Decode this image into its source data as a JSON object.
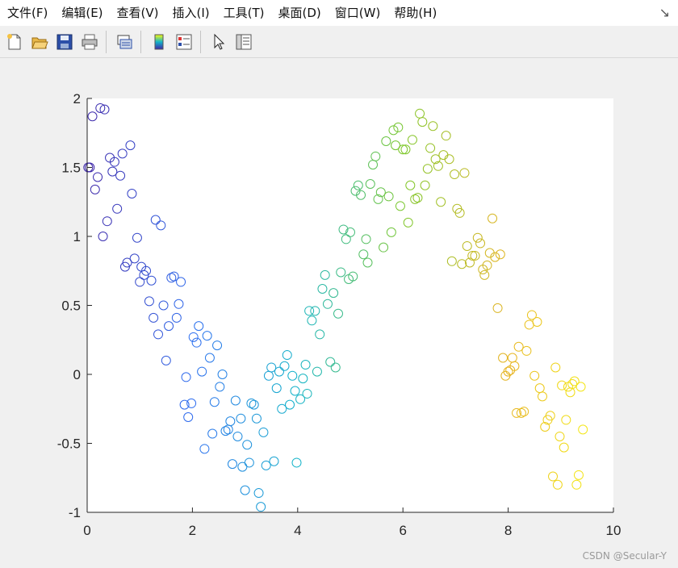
{
  "menu": {
    "items": [
      "文件(F)",
      "编辑(E)",
      "查看(V)",
      "插入(I)",
      "工具(T)",
      "桌面(D)",
      "窗口(W)",
      "帮助(H)"
    ]
  },
  "toolbar": {
    "buttons": [
      "new-figure-icon",
      "open-file-icon",
      "save-icon",
      "print-icon",
      "link-plot-icon",
      "colorbar-icon",
      "legend-icon",
      "edit-plot-arrow-icon",
      "property-inspector-icon"
    ]
  },
  "chart_data": {
    "type": "scatter",
    "marker": "open-circle",
    "color_map": "parula",
    "colors": [
      "#3e26a8",
      "#2f6ff0",
      "#13b4c9",
      "#7cc72a",
      "#e6b321",
      "#f9fb0e"
    ],
    "xlim": [
      0,
      10
    ],
    "ylim": [
      -1,
      2
    ],
    "xticks": [
      "0",
      "2",
      "4",
      "6",
      "8",
      "10"
    ],
    "yticks": [
      "-1",
      "-0.5",
      "0",
      "0.5",
      "1",
      "1.5",
      "2"
    ],
    "grid": false,
    "points": [
      [
        0.02,
        1.5
      ],
      [
        0.05,
        1.5
      ],
      [
        0.1,
        1.87
      ],
      [
        0.15,
        1.34
      ],
      [
        0.2,
        1.43
      ],
      [
        0.25,
        1.93
      ],
      [
        0.3,
        1.0
      ],
      [
        0.33,
        1.92
      ],
      [
        0.38,
        1.11
      ],
      [
        0.43,
        1.57
      ],
      [
        0.48,
        1.47
      ],
      [
        0.52,
        1.54
      ],
      [
        0.57,
        1.2
      ],
      [
        0.63,
        1.44
      ],
      [
        0.67,
        1.6
      ],
      [
        0.72,
        0.78
      ],
      [
        0.76,
        0.81
      ],
      [
        0.82,
        1.66
      ],
      [
        0.85,
        1.31
      ],
      [
        0.9,
        0.84
      ],
      [
        0.95,
        0.99
      ],
      [
        1.0,
        0.67
      ],
      [
        1.03,
        0.78
      ],
      [
        1.08,
        0.72
      ],
      [
        1.12,
        0.75
      ],
      [
        1.18,
        0.53
      ],
      [
        1.22,
        0.68
      ],
      [
        1.26,
        0.41
      ],
      [
        1.3,
        1.12
      ],
      [
        1.35,
        0.29
      ],
      [
        1.4,
        1.08
      ],
      [
        1.45,
        0.5
      ],
      [
        1.5,
        0.1
      ],
      [
        1.55,
        0.35
      ],
      [
        1.6,
        0.7
      ],
      [
        1.65,
        0.71
      ],
      [
        1.7,
        0.41
      ],
      [
        1.74,
        0.51
      ],
      [
        1.78,
        0.67
      ],
      [
        1.85,
        -0.22
      ],
      [
        1.88,
        -0.02
      ],
      [
        1.92,
        -0.31
      ],
      [
        1.98,
        -0.21
      ],
      [
        2.02,
        0.27
      ],
      [
        2.08,
        0.23
      ],
      [
        2.12,
        0.35
      ],
      [
        2.18,
        0.02
      ],
      [
        2.23,
        -0.54
      ],
      [
        2.28,
        0.28
      ],
      [
        2.33,
        0.12
      ],
      [
        2.38,
        -0.43
      ],
      [
        2.42,
        -0.2
      ],
      [
        2.47,
        0.21
      ],
      [
        2.52,
        -0.09
      ],
      [
        2.57,
        0.0
      ],
      [
        2.63,
        -0.41
      ],
      [
        2.68,
        -0.4
      ],
      [
        2.72,
        -0.34
      ],
      [
        2.76,
        -0.65
      ],
      [
        2.82,
        -0.19
      ],
      [
        2.86,
        -0.45
      ],
      [
        2.92,
        -0.32
      ],
      [
        2.95,
        -0.67
      ],
      [
        3.0,
        -0.84
      ],
      [
        3.04,
        -0.51
      ],
      [
        3.08,
        -0.64
      ],
      [
        3.12,
        -0.21
      ],
      [
        3.17,
        -0.22
      ],
      [
        3.22,
        -0.32
      ],
      [
        3.26,
        -0.86
      ],
      [
        3.3,
        -0.96
      ],
      [
        3.35,
        -0.42
      ],
      [
        3.4,
        -0.66
      ],
      [
        3.45,
        -0.01
      ],
      [
        3.5,
        0.05
      ],
      [
        3.55,
        -0.63
      ],
      [
        3.6,
        -0.1
      ],
      [
        3.65,
        0.02
      ],
      [
        3.7,
        -0.25
      ],
      [
        3.75,
        0.06
      ],
      [
        3.8,
        0.14
      ],
      [
        3.85,
        -0.22
      ],
      [
        3.9,
        -0.01
      ],
      [
        3.95,
        -0.12
      ],
      [
        3.98,
        -0.64
      ],
      [
        4.05,
        -0.18
      ],
      [
        4.1,
        -0.03
      ],
      [
        4.15,
        0.07
      ],
      [
        4.18,
        -0.14
      ],
      [
        4.22,
        0.46
      ],
      [
        4.27,
        0.39
      ],
      [
        4.33,
        0.46
      ],
      [
        4.37,
        0.02
      ],
      [
        4.42,
        0.29
      ],
      [
        4.47,
        0.62
      ],
      [
        4.52,
        0.72
      ],
      [
        4.57,
        0.51
      ],
      [
        4.62,
        0.09
      ],
      [
        4.68,
        0.59
      ],
      [
        4.72,
        0.05
      ],
      [
        4.77,
        0.44
      ],
      [
        4.82,
        0.74
      ],
      [
        4.87,
        1.05
      ],
      [
        4.92,
        0.98
      ],
      [
        4.97,
        0.69
      ],
      [
        5.0,
        1.03
      ],
      [
        5.05,
        0.71
      ],
      [
        5.1,
        1.33
      ],
      [
        5.15,
        1.37
      ],
      [
        5.2,
        1.3
      ],
      [
        5.25,
        0.87
      ],
      [
        5.3,
        0.98
      ],
      [
        5.33,
        0.81
      ],
      [
        5.38,
        1.38
      ],
      [
        5.43,
        1.52
      ],
      [
        5.48,
        1.58
      ],
      [
        5.53,
        1.27
      ],
      [
        5.58,
        1.32
      ],
      [
        5.63,
        0.92
      ],
      [
        5.68,
        1.69
      ],
      [
        5.73,
        1.29
      ],
      [
        5.78,
        1.03
      ],
      [
        5.82,
        1.77
      ],
      [
        5.86,
        1.66
      ],
      [
        5.91,
        1.79
      ],
      [
        5.95,
        1.22
      ],
      [
        6.0,
        1.63
      ],
      [
        6.05,
        1.63
      ],
      [
        6.1,
        1.1
      ],
      [
        6.14,
        1.37
      ],
      [
        6.18,
        1.7
      ],
      [
        6.23,
        1.27
      ],
      [
        6.28,
        1.28
      ],
      [
        6.32,
        1.89
      ],
      [
        6.37,
        1.83
      ],
      [
        6.42,
        1.37
      ],
      [
        6.47,
        1.49
      ],
      [
        6.52,
        1.64
      ],
      [
        6.57,
        1.8
      ],
      [
        6.62,
        1.56
      ],
      [
        6.67,
        1.51
      ],
      [
        6.72,
        1.25
      ],
      [
        6.77,
        1.59
      ],
      [
        6.82,
        1.73
      ],
      [
        6.88,
        1.56
      ],
      [
        6.93,
        0.82
      ],
      [
        6.98,
        1.45
      ],
      [
        7.03,
        1.2
      ],
      [
        7.08,
        1.17
      ],
      [
        7.12,
        0.8
      ],
      [
        7.17,
        1.46
      ],
      [
        7.22,
        0.93
      ],
      [
        7.27,
        0.81
      ],
      [
        7.32,
        0.86
      ],
      [
        7.37,
        0.86
      ],
      [
        7.42,
        0.99
      ],
      [
        7.47,
        0.95
      ],
      [
        7.52,
        0.76
      ],
      [
        7.55,
        0.72
      ],
      [
        7.6,
        0.79
      ],
      [
        7.65,
        0.88
      ],
      [
        7.7,
        1.13
      ],
      [
        7.75,
        0.85
      ],
      [
        7.8,
        0.48
      ],
      [
        7.85,
        0.87
      ],
      [
        7.9,
        0.12
      ],
      [
        7.95,
        -0.01
      ],
      [
        8.0,
        0.02
      ],
      [
        8.04,
        0.03
      ],
      [
        8.08,
        0.12
      ],
      [
        8.12,
        0.06
      ],
      [
        8.16,
        -0.28
      ],
      [
        8.2,
        0.2
      ],
      [
        8.25,
        -0.28
      ],
      [
        8.3,
        -0.27
      ],
      [
        8.35,
        0.17
      ],
      [
        8.4,
        0.36
      ],
      [
        8.45,
        0.43
      ],
      [
        8.5,
        -0.01
      ],
      [
        8.55,
        0.38
      ],
      [
        8.6,
        -0.1
      ],
      [
        8.65,
        -0.16
      ],
      [
        8.7,
        -0.38
      ],
      [
        8.75,
        -0.33
      ],
      [
        8.8,
        -0.3
      ],
      [
        8.85,
        -0.74
      ],
      [
        8.9,
        0.05
      ],
      [
        8.94,
        -0.8
      ],
      [
        8.98,
        -0.45
      ],
      [
        9.02,
        -0.08
      ],
      [
        9.06,
        -0.53
      ],
      [
        9.1,
        -0.33
      ],
      [
        9.14,
        -0.09
      ],
      [
        9.18,
        -0.13
      ],
      [
        9.22,
        -0.07
      ],
      [
        9.26,
        -0.05
      ],
      [
        9.3,
        -0.8
      ],
      [
        9.34,
        -0.73
      ],
      [
        9.38,
        -0.09
      ],
      [
        9.42,
        -0.4
      ]
    ]
  },
  "watermark": "CSDN @Secular-Y"
}
